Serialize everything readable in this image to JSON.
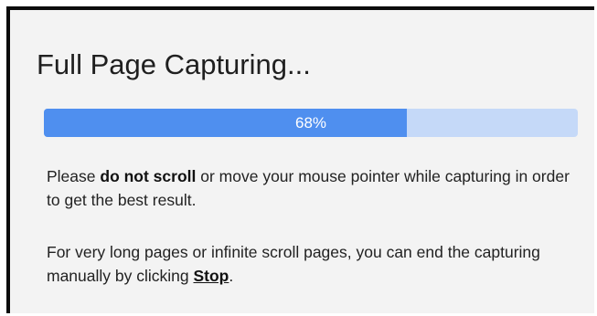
{
  "dialog": {
    "title": "Full Page Capturing...",
    "progress": {
      "value": 0.68,
      "label": "68%"
    },
    "message1": {
      "part1": "Please ",
      "bold": "do not scroll",
      "part2": " or move your mouse pointer while capturing in order to get the best result."
    },
    "message2": {
      "text": "For very long pages or infinite scroll pages, you can end the capturing manually by clicking ",
      "link": "Stop",
      "suffix": "."
    }
  },
  "colors": {
    "progress_fill": "#4f8fef",
    "progress_track": "#c5d9f8",
    "panel_background": "#f3f3f3",
    "text": "#222222"
  }
}
